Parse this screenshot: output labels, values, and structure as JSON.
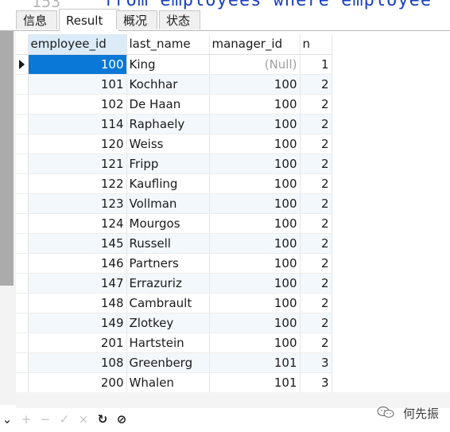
{
  "editor": {
    "line_number": "153",
    "code_fragment": "from employees where employee"
  },
  "tabs": [
    {
      "label": "信息",
      "active": false
    },
    {
      "label": "Result 1",
      "active": true
    },
    {
      "label": "概况",
      "active": false
    },
    {
      "label": "状态",
      "active": false
    }
  ],
  "grid": {
    "columns": [
      "employee_id",
      "last_name",
      "manager_id",
      "n"
    ],
    "selected_column": "employee_id",
    "rows": [
      {
        "employee_id": "100",
        "last_name": "King",
        "manager_id": "(Null)",
        "n": "1"
      },
      {
        "employee_id": "101",
        "last_name": "Kochhar",
        "manager_id": "100",
        "n": "2"
      },
      {
        "employee_id": "102",
        "last_name": "De Haan",
        "manager_id": "100",
        "n": "2"
      },
      {
        "employee_id": "114",
        "last_name": "Raphaely",
        "manager_id": "100",
        "n": "2"
      },
      {
        "employee_id": "120",
        "last_name": "Weiss",
        "manager_id": "100",
        "n": "2"
      },
      {
        "employee_id": "121",
        "last_name": "Fripp",
        "manager_id": "100",
        "n": "2"
      },
      {
        "employee_id": "122",
        "last_name": "Kaufling",
        "manager_id": "100",
        "n": "2"
      },
      {
        "employee_id": "123",
        "last_name": "Vollman",
        "manager_id": "100",
        "n": "2"
      },
      {
        "employee_id": "124",
        "last_name": "Mourgos",
        "manager_id": "100",
        "n": "2"
      },
      {
        "employee_id": "145",
        "last_name": "Russell",
        "manager_id": "100",
        "n": "2"
      },
      {
        "employee_id": "146",
        "last_name": "Partners",
        "manager_id": "100",
        "n": "2"
      },
      {
        "employee_id": "147",
        "last_name": "Errazuriz",
        "manager_id": "100",
        "n": "2"
      },
      {
        "employee_id": "148",
        "last_name": "Cambrault",
        "manager_id": "100",
        "n": "2"
      },
      {
        "employee_id": "149",
        "last_name": "Zlotkey",
        "manager_id": "100",
        "n": "2"
      },
      {
        "employee_id": "201",
        "last_name": "Hartstein",
        "manager_id": "100",
        "n": "2"
      },
      {
        "employee_id": "108",
        "last_name": "Greenberg",
        "manager_id": "101",
        "n": "3"
      },
      {
        "employee_id": "200",
        "last_name": "Whalen",
        "manager_id": "101",
        "n": "3"
      }
    ]
  },
  "toolbar": {
    "buttons": [
      {
        "name": "add-record-button",
        "glyph": "+",
        "enabled": false
      },
      {
        "name": "delete-record-button",
        "glyph": "−",
        "enabled": false
      },
      {
        "name": "apply-changes-button",
        "glyph": "✓",
        "enabled": false
      },
      {
        "name": "discard-changes-button",
        "glyph": "×",
        "enabled": false
      },
      {
        "name": "refresh-button",
        "glyph": "↻",
        "enabled": true
      },
      {
        "name": "stop-button",
        "glyph": "⊘",
        "enabled": true
      }
    ]
  },
  "watermark": {
    "text": "何先振"
  },
  "colors": {
    "selection": "#0a78d7",
    "selected_header": "#dcebf8",
    "null_text": "#a0a0a0",
    "alt_row": "#f3f8fc"
  }
}
